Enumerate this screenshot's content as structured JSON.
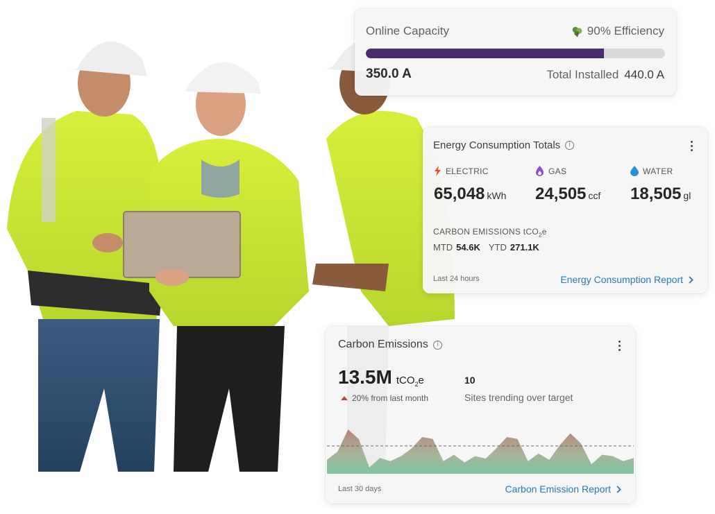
{
  "capacity": {
    "title": "Online Capacity",
    "efficiency": "90% Efficiency",
    "efficiency_icon": "leaf-icon",
    "online_fraction": 0.795,
    "online_value": "350.0 A",
    "total_label": "Total Installed",
    "total_value": "440.0 A",
    "bar_color": "#4a2d6f"
  },
  "energy": {
    "title": "Energy Consumption Totals",
    "utilities": [
      {
        "label": "ELECTRIC",
        "value": "65,048",
        "unit": "kWh",
        "icon": "lightning-icon",
        "color": "#e0522f"
      },
      {
        "label": "GAS",
        "value": "24,505",
        "unit": "ccf",
        "icon": "flame-icon",
        "color": "#8a4fd1"
      },
      {
        "label": "WATER",
        "value": "18,505",
        "unit": "gl",
        "icon": "water-drop-icon",
        "color": "#2c8fd6"
      }
    ],
    "carbon_label": "CARBON EMISSIONS tCO",
    "carbon_sub": "2",
    "carbon_suffix": "e",
    "mtd_label": "MTD",
    "mtd_value": "54.6K",
    "ytd_label": "YTD",
    "ytd_value": "271.1K",
    "period": "Last 24 hours",
    "link": "Energy Consumption Report"
  },
  "carbon": {
    "title": "Carbon Emissions",
    "value": "13.5M",
    "unit": "tCO",
    "unit_sub": "2",
    "unit_suffix": "e",
    "trend": "20% from last month",
    "sites_count": "10",
    "sites_label": "Sites trending over target",
    "period": "Last 30 days",
    "link": "Carbon Emission Report",
    "spark_values": [
      22,
      35,
      70,
      55,
      10,
      25,
      20,
      28,
      40,
      58,
      55,
      20,
      30,
      18,
      28,
      24,
      40,
      58,
      55,
      20,
      32,
      22,
      45,
      64,
      48,
      15,
      30,
      28,
      20,
      25
    ],
    "spark_target": 44,
    "spark_max": 80
  }
}
